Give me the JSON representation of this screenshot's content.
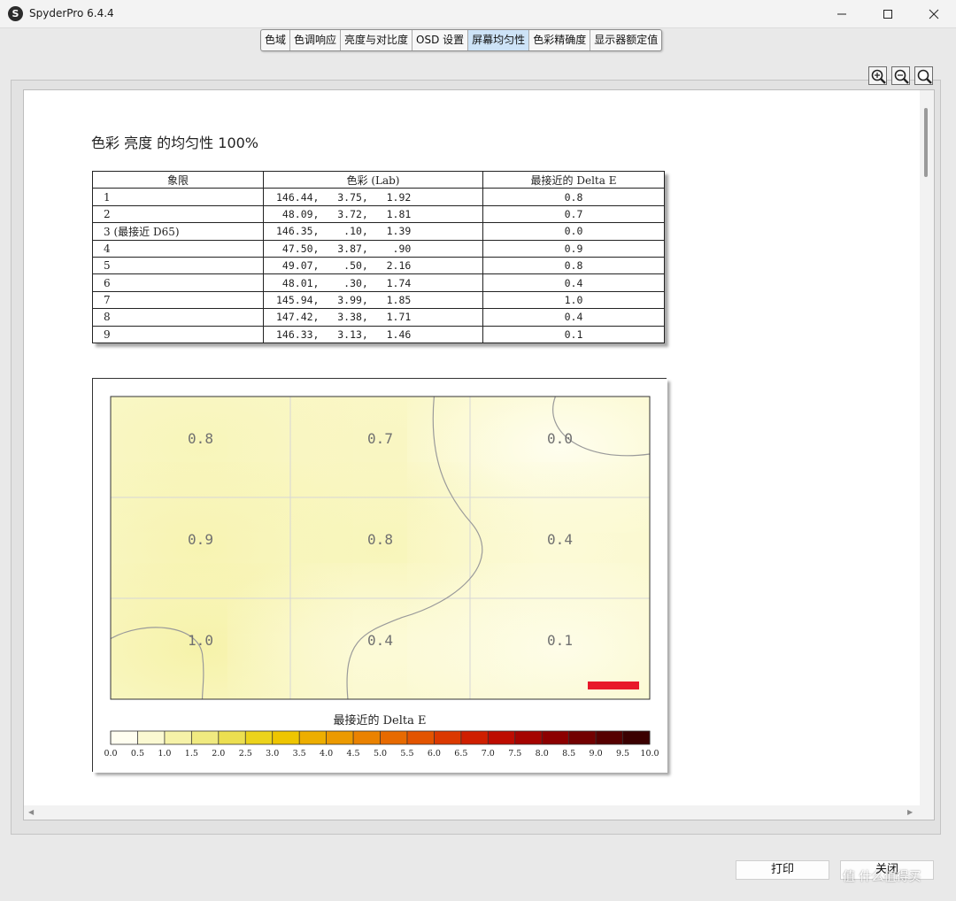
{
  "window": {
    "title": "SpyderPro 6.4.4",
    "icon_letter": "S"
  },
  "tabs": [
    {
      "label": "色域",
      "active": false
    },
    {
      "label": "色调响应",
      "active": false
    },
    {
      "label": "亮度与对比度",
      "active": false
    },
    {
      "label": "OSD 设置",
      "active": false
    },
    {
      "label": "屏幕均匀性",
      "active": true
    },
    {
      "label": "色彩精确度",
      "active": false
    },
    {
      "label": "显示器额定值",
      "active": false
    }
  ],
  "zoom_icons": [
    "zoom-in-icon",
    "zoom-out-icon",
    "zoom-fit-icon"
  ],
  "report": {
    "heading": "色彩 亮度 的均匀性 100%",
    "table": {
      "headers": [
        "象限",
        "色彩 (Lab)",
        "最接近的 Delta E"
      ],
      "rows": [
        [
          "1",
          "146.44,   3.75,   1.92",
          "0.8"
        ],
        [
          "2",
          " 48.09,   3.72,   1.81",
          "0.7"
        ],
        [
          "3 (最接近 D65)",
          "146.35,    .10,   1.39",
          "0.0"
        ],
        [
          "4",
          " 47.50,   3.87,    .90",
          "0.9"
        ],
        [
          "5",
          " 49.07,    .50,   2.16",
          "0.8"
        ],
        [
          "6",
          " 48.01,    .30,   1.74",
          "0.4"
        ],
        [
          "7",
          "145.94,   3.99,   1.85",
          "1.0"
        ],
        [
          "8",
          "147.42,   3.38,   1.71",
          "0.4"
        ],
        [
          "9",
          "146.33,   3.13,   1.46",
          "0.1"
        ]
      ]
    }
  },
  "chart_data": {
    "type": "heatmap",
    "rows": 3,
    "cols": 3,
    "values": [
      [
        0.8,
        0.7,
        0.0
      ],
      [
        0.9,
        0.8,
        0.4
      ],
      [
        1.0,
        0.4,
        0.1
      ]
    ],
    "cell_labels": [
      [
        "0.8",
        "0.7",
        "0.0"
      ],
      [
        "0.9",
        "0.8",
        "0.4"
      ],
      [
        "1.0",
        "0.4",
        "0.1"
      ]
    ],
    "contour_level": 0.5,
    "colorbar": {
      "title": "最接近的 Delta E",
      "range": [
        0,
        10
      ],
      "ticks": [
        "0.0",
        "0.5",
        "1.0",
        "1.5",
        "2.0",
        "2.5",
        "3.0",
        "3.5",
        "4.0",
        "4.5",
        "5.0",
        "5.5",
        "6.0",
        "6.5",
        "7.0",
        "7.5",
        "8.0",
        "8.5",
        "9.0",
        "9.5",
        "10.0"
      ],
      "colors": [
        "#fffef0",
        "#fbf9d2",
        "#f6f2a8",
        "#f0ea80",
        "#ecdf50",
        "#ecd31b",
        "#eec500",
        "#edae00",
        "#ec9a00",
        "#ea8200",
        "#e76a00",
        "#e35400",
        "#db3900",
        "#cf1f00",
        "#bd0c00",
        "#a50400",
        "#8c0000",
        "#720000",
        "#560000",
        "#3b0000"
      ]
    },
    "indicator_color": "#e8182a",
    "grid": true
  },
  "buttons": {
    "print": "打印",
    "close": "关闭"
  },
  "watermark": "值 什么值得买"
}
